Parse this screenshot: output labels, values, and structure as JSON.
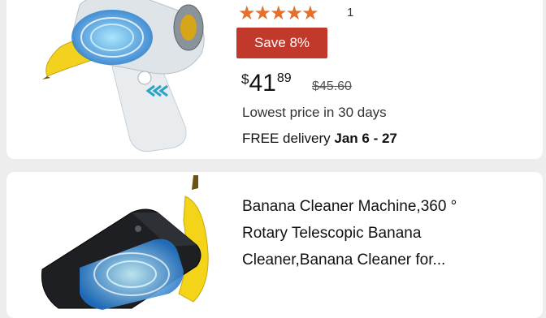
{
  "product1": {
    "stars": "★★★★★",
    "rating_count": "1",
    "save_badge": "Save 8%",
    "price_symbol": "$",
    "price_whole": "41",
    "price_fraction": "89",
    "old_price": "$45.60",
    "lowest_price_note": "Lowest price in 30 days",
    "delivery_prefix": "FREE delivery",
    "delivery_dates": "Jan 6 - 27"
  },
  "product2": {
    "title_lines": [
      "Banana Cleaner Machine,360 °",
      "Rotary Telescopic Banana",
      "Cleaner,Banana Cleaner for..."
    ]
  },
  "colors": {
    "star": "#e4702b",
    "save_badge_bg": "#c0392b",
    "page_bg": "#ededed",
    "card_bg": "#ffffff"
  }
}
